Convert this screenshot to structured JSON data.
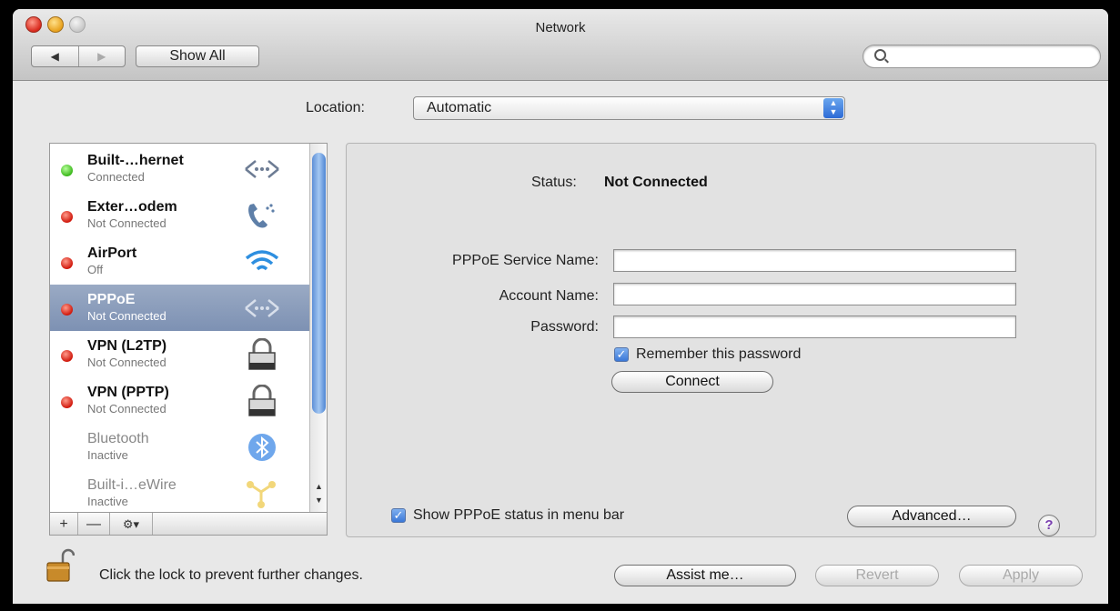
{
  "window": {
    "title": "Network"
  },
  "toolbar": {
    "back_label": "◀",
    "forward_label": "▶",
    "show_all_label": "Show All",
    "search_placeholder": ""
  },
  "location": {
    "label": "Location:",
    "value": "Automatic"
  },
  "services": [
    {
      "name": "Built-…hernet",
      "status": "Connected",
      "indicator": "green",
      "icon": "ethernet-arrows-icon"
    },
    {
      "name": "Exter…odem",
      "status": "Not Connected",
      "indicator": "red",
      "icon": "phone-modem-icon"
    },
    {
      "name": "AirPort",
      "status": "Off",
      "indicator": "red",
      "icon": "wifi-icon"
    },
    {
      "name": "PPPoE",
      "status": "Not Connected",
      "indicator": "red",
      "icon": "ethernet-arrows-icon",
      "selected": true
    },
    {
      "name": "VPN (L2TP)",
      "status": "Not Connected",
      "indicator": "red",
      "icon": "lock-icon"
    },
    {
      "name": "VPN (PPTP)",
      "status": "Not Connected",
      "indicator": "red",
      "icon": "lock-icon"
    },
    {
      "name": "Bluetooth",
      "status": "Inactive",
      "indicator": "none",
      "icon": "bluetooth-icon"
    },
    {
      "name": "Built-i…eWire",
      "status": "Inactive",
      "indicator": "none",
      "icon": "firewire-icon"
    }
  ],
  "sidebar_footer": {
    "add_label": "+",
    "remove_label": "—",
    "action_label": "⚙▾"
  },
  "detail": {
    "status_label": "Status:",
    "status_value": "Not Connected",
    "service_name_label": "PPPoE Service Name:",
    "service_name_value": "",
    "account_name_label": "Account Name:",
    "account_name_value": "",
    "password_label": "Password:",
    "password_value": "",
    "remember_label": "Remember this password",
    "remember_checked": true,
    "connect_label": "Connect",
    "show_status_label": "Show PPPoE status in menu bar",
    "show_status_checked": true,
    "advanced_label": "Advanced…",
    "help_label": "?"
  },
  "footer": {
    "lock_text": "Click the lock to prevent further changes.",
    "assist_label": "Assist me…",
    "revert_label": "Revert",
    "apply_label": "Apply"
  },
  "colors": {
    "selection": "#8a9cbc",
    "accent": "#3b78d8",
    "status_green": "#3cb81c",
    "status_red": "#d0180c"
  }
}
